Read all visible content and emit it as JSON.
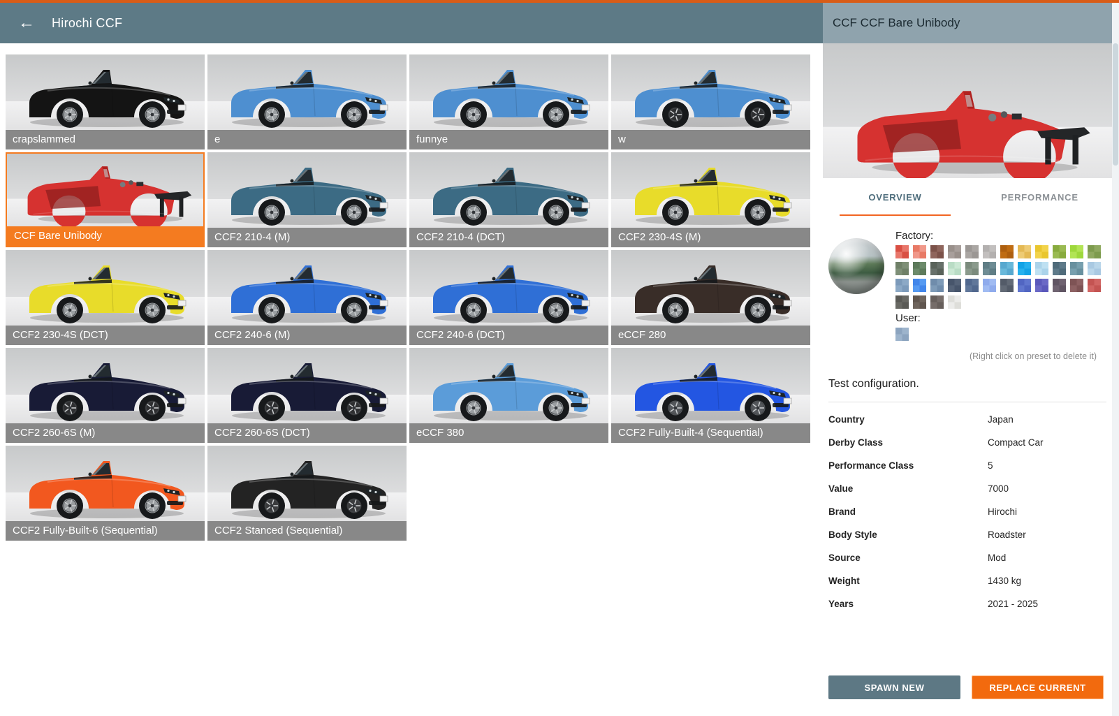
{
  "header": {
    "back_glyph": "←",
    "title": "Hirochi CCF"
  },
  "grid": {
    "items": [
      {
        "label": "crapslammed",
        "color": "#141414",
        "type": "car",
        "wheel": "#9a9ea1",
        "selected": false
      },
      {
        "label": "e",
        "color": "#4e8fd0",
        "type": "car",
        "wheel": "#9a9ea1",
        "selected": false
      },
      {
        "label": "funnye",
        "color": "#4e8fd0",
        "type": "car",
        "wheel": "#9a9ea1",
        "selected": false
      },
      {
        "label": "w",
        "color": "#4e8fd0",
        "type": "car",
        "wheel": "#2e2f31",
        "selected": false
      },
      {
        "label": "CCF Bare Unibody",
        "color": "#d63230",
        "type": "unibody",
        "wheel": "#9a9ea1",
        "selected": true
      },
      {
        "label": "CCF2 210-4 (M)",
        "color": "#3c6b84",
        "type": "car",
        "wheel": "#9a9ea1",
        "selected": false
      },
      {
        "label": "CCF2 210-4 (DCT)",
        "color": "#3c6b84",
        "type": "car",
        "wheel": "#9a9ea1",
        "selected": false
      },
      {
        "label": "CCF2 230-4S (M)",
        "color": "#e8dc2a",
        "type": "car",
        "wheel": "#9a9ea1",
        "selected": false
      },
      {
        "label": "CCF2 230-4S (DCT)",
        "color": "#e8dc2a",
        "type": "car",
        "wheel": "#9a9ea1",
        "selected": false
      },
      {
        "label": "CCF2 240-6 (M)",
        "color": "#2f6fd6",
        "type": "car",
        "wheel": "#9a9ea1",
        "selected": false
      },
      {
        "label": "CCF2 240-6 (DCT)",
        "color": "#2f6fd6",
        "type": "car",
        "wheel": "#9a9ea1",
        "selected": false
      },
      {
        "label": "eCCF 280",
        "color": "#392d28",
        "type": "car",
        "wheel": "#9a9ea1",
        "selected": false
      },
      {
        "label": "CCF2 260-6S (M)",
        "color": "#181b36",
        "type": "car",
        "wheel": "#2e2f31",
        "selected": false
      },
      {
        "label": "CCF2 260-6S (DCT)",
        "color": "#181b36",
        "type": "car",
        "wheel": "#2e2f31",
        "selected": false
      },
      {
        "label": "eCCF 380",
        "color": "#5b9cd9",
        "type": "car",
        "wheel": "#9a9ea1",
        "selected": false
      },
      {
        "label": "CCF2 Fully-Built-4 (Sequential)",
        "color": "#2356e2",
        "type": "car",
        "wheel": "#55585c",
        "selected": false
      },
      {
        "label": "CCF2 Fully-Built-6 (Sequential)",
        "color": "#f2581f",
        "type": "car",
        "wheel": "#9a9ea1",
        "selected": false
      },
      {
        "label": "CCF2 Stanced (Sequential)",
        "color": "#232323",
        "type": "car",
        "wheel": "#3a3b3d",
        "selected": false
      }
    ]
  },
  "panel": {
    "title": "CCF CCF Bare Unibody",
    "preview_color": "#d63230",
    "tabs": [
      {
        "label": "OVERVIEW",
        "active": true
      },
      {
        "label": "PERFORMANCE",
        "active": false
      }
    ],
    "factory_label": "Factory:",
    "user_label": "User:",
    "hint": "(Right click on preset to delete it)",
    "description": "Test configuration.",
    "factory_colors": [
      [
        [
          "#d94f43",
          "#e8766a"
        ],
        [
          "#e87a66",
          "#f0988a"
        ],
        [
          "#7c524a",
          "#8f655c"
        ],
        [
          "#99908b",
          "#a89f9b"
        ],
        [
          "#9b9794",
          "#aaa6a3"
        ],
        [
          "#b3b0af",
          "#c2bfbe"
        ],
        [
          "#ae5f0f",
          "#bf6c13"
        ],
        [
          "#e4b954",
          "#eecb74"
        ],
        [
          "#e9c62e",
          "#f2d34a"
        ],
        [
          "#88ab3e",
          "#9aba52"
        ],
        [
          "#9ed83c",
          "#b2e455"
        ],
        [
          "#7d9b4e",
          "#8fa960"
        ]
      ],
      [
        [
          "#6f8068",
          "#7e8f77"
        ],
        [
          "#5d7a5b",
          "#6c8a6a"
        ],
        [
          "#59625a",
          "#67706a"
        ],
        [
          "#b9dcc5",
          "#cbe8d4"
        ],
        [
          "#7b8b7d",
          "#8a9a8c"
        ],
        [
          "#5f7d85",
          "#6e8c94"
        ],
        [
          "#57a8cf",
          "#68b8da"
        ],
        [
          "#12a3e6",
          "#25b1ee"
        ],
        [
          "#abd3ea",
          "#bee0f2"
        ],
        [
          "#4f6b7a",
          "#5e7a89"
        ],
        [
          "#68909f",
          "#779fae"
        ],
        [
          "#a9c9e2",
          "#b9d6ea"
        ]
      ],
      [
        [
          "#7c9aba",
          "#8ca9c6"
        ],
        [
          "#4286ea",
          "#569af2"
        ],
        [
          "#6f8cab",
          "#7e9bb8"
        ],
        [
          "#47556b",
          "#556378"
        ],
        [
          "#51688e",
          "#60779a"
        ],
        [
          "#8fabec",
          "#a0bbf2"
        ],
        [
          "#535b68",
          "#626a76"
        ],
        [
          "#5166c2",
          "#6076ce"
        ],
        [
          "#5a58bb",
          "#6a68c6"
        ],
        [
          "#605563",
          "#6f6371"
        ],
        [
          "#7e5355",
          "#8d6163"
        ],
        [
          "#c45452",
          "#d16563"
        ]
      ],
      [
        [
          "#595955",
          "#686863"
        ],
        [
          "#60564f",
          "#6f655d"
        ],
        [
          "#675f5b",
          "#766d69"
        ],
        [
          "#dededa",
          "#ececea"
        ]
      ]
    ],
    "user_colors": [
      [
        "#8ca4bf",
        "#9db4cc"
      ]
    ],
    "details": [
      {
        "label": "Country",
        "value": "Japan"
      },
      {
        "label": "Derby Class",
        "value": "Compact Car"
      },
      {
        "label": "Performance Class",
        "value": "5"
      },
      {
        "label": "Value",
        "value": "7000"
      },
      {
        "label": "Brand",
        "value": "Hirochi"
      },
      {
        "label": "Body Style",
        "value": "Roadster"
      },
      {
        "label": "Source",
        "value": "Mod"
      },
      {
        "label": "Weight",
        "value": "1430 kg"
      },
      {
        "label": "Years",
        "value": "2021 - 2025"
      }
    ],
    "buttons": {
      "spawn": "SPAWN NEW",
      "replace": "REPLACE CURRENT"
    }
  },
  "colors": {
    "accent_orange": "#f26522",
    "selected_orange": "#f47b20",
    "header_dark": "#5d7a86",
    "header_light": "#8fa3ad",
    "top_strip": "#d85c17"
  }
}
